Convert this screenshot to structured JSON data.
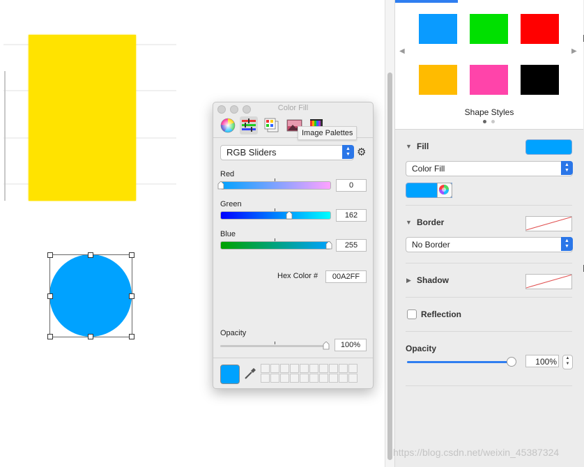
{
  "colors": {
    "accent": "#2f7ef0",
    "fill_blue": "#00A2FF",
    "yellow": "#FFE300",
    "style_swatches": [
      "#0a9bff",
      "#00e000",
      "#ff0000",
      "#ffbb00",
      "#ff44aa",
      "#000000"
    ]
  },
  "color_fill_window": {
    "title": "Color Fill",
    "tool_icons": [
      "color-wheel-icon",
      "color-sliders-icon",
      "color-palettes-icon",
      "image-palettes-icon",
      "pencils-icon"
    ],
    "tooltip": "Image Palettes",
    "mode": "RGB Sliders",
    "sliders": [
      {
        "label": "Red",
        "value": "0",
        "level": 0.0
      },
      {
        "label": "Green",
        "value": "162",
        "level": 0.635
      },
      {
        "label": "Blue",
        "value": "255",
        "level": 1.0
      }
    ],
    "hex_label": "Hex Color #",
    "hex_value": "00A2FF",
    "opacity_label": "Opacity",
    "opacity_value": "100%",
    "opacity_level": 1.0
  },
  "inspector": {
    "shape_styles_label": "Shape Styles",
    "fill": {
      "title": "Fill",
      "type": "Color Fill",
      "color": "#00A2FF"
    },
    "border": {
      "title": "Border",
      "type": "No Border"
    },
    "shadow": {
      "title": "Shadow"
    },
    "reflection": {
      "label": "Reflection",
      "checked": false
    },
    "opacity": {
      "title": "Opacity",
      "value": "100%",
      "level": 1.0
    }
  },
  "watermark": "https://blog.csdn.net/weixin_45387324"
}
